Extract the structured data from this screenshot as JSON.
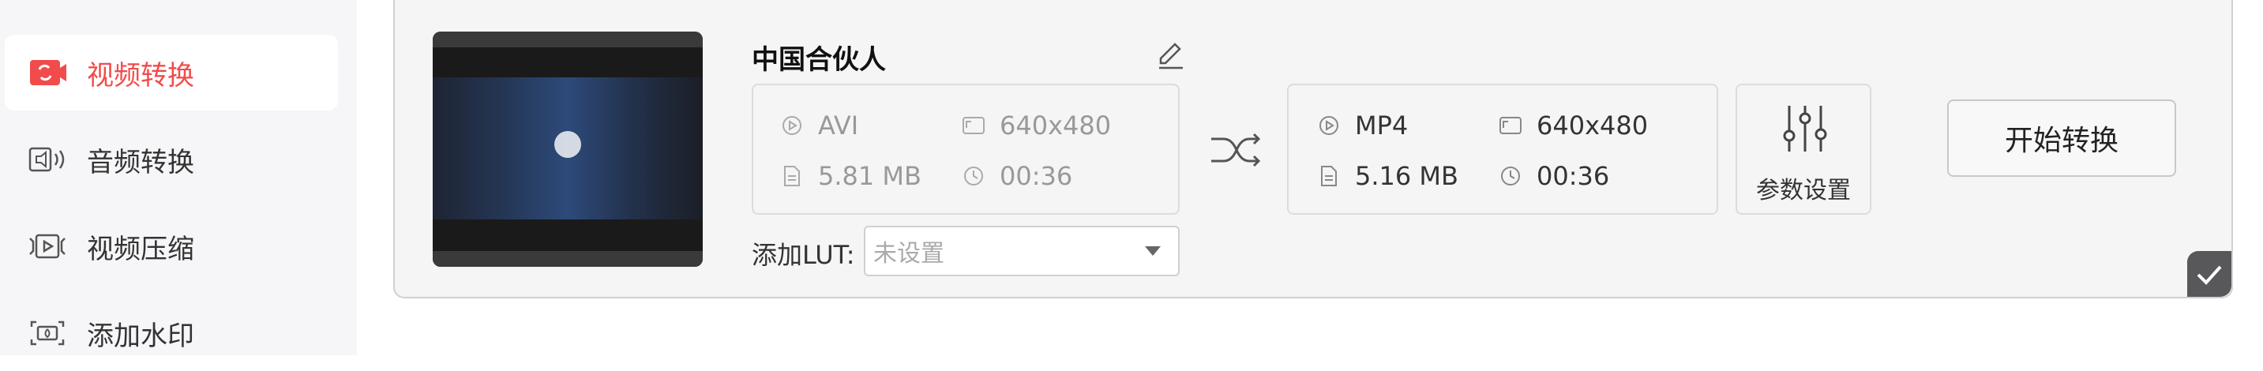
{
  "sidebar": {
    "items": [
      {
        "label": "视频转换",
        "icon": "video-convert-icon",
        "active": true
      },
      {
        "label": "音频转换",
        "icon": "audio-convert-icon",
        "active": false
      },
      {
        "label": "视频压缩",
        "icon": "video-compress-icon",
        "active": false
      },
      {
        "label": "添加水印",
        "icon": "watermark-icon",
        "active": false
      }
    ]
  },
  "task": {
    "title": "中国合伙人",
    "input": {
      "format": "AVI",
      "resolution": "640x480",
      "size": "5.81 MB",
      "duration": "00:36"
    },
    "output": {
      "format": "MP4",
      "resolution": "640x480",
      "size": "5.16 MB",
      "duration": "00:36"
    },
    "param_label": "参数设置",
    "start_label": "开始转换",
    "lut_label": "添加LUT:",
    "lut_value": "未设置"
  },
  "colors": {
    "accent": "#f24b4b",
    "sidebar_bg": "#f6f6f8",
    "card_bg": "#f5f5f6"
  }
}
